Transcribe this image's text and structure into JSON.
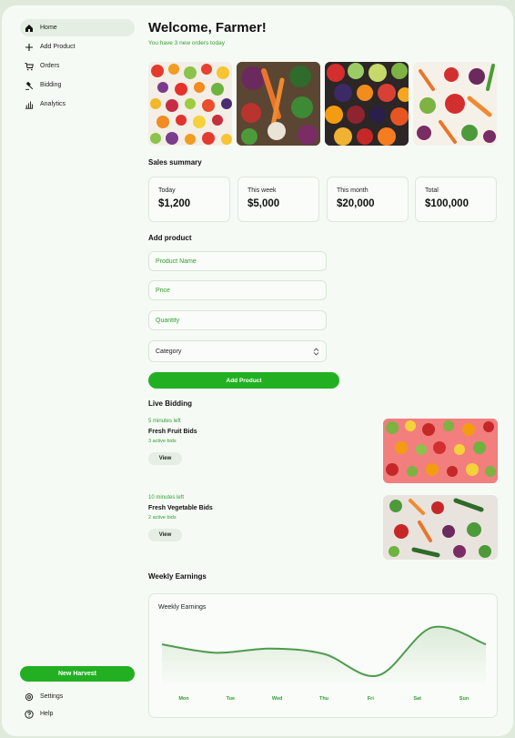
{
  "sidebar": {
    "items": [
      {
        "label": "Home",
        "icon": "home-icon",
        "active": true
      },
      {
        "label": "Add Product",
        "icon": "plus-icon"
      },
      {
        "label": "Orders",
        "icon": "cart-icon"
      },
      {
        "label": "Bidding",
        "icon": "gavel-icon"
      },
      {
        "label": "Analytics",
        "icon": "bar-chart-icon"
      }
    ],
    "new_harvest_label": "New Harvest",
    "settings_label": "Settings",
    "help_label": "Help"
  },
  "header": {
    "title": "Welcome, Farmer!",
    "subtitle": "You have 3 new orders today"
  },
  "sales": {
    "title": "Sales summary",
    "cards": [
      {
        "label": "Today",
        "value": "$1,200"
      },
      {
        "label": "This week",
        "value": "$5,000"
      },
      {
        "label": "This month",
        "value": "$20,000"
      },
      {
        "label": "Total",
        "value": "$100,000"
      }
    ]
  },
  "add_product": {
    "title": "Add product",
    "name_placeholder": "Product Name",
    "price_placeholder": "Price",
    "quantity_placeholder": "Quantity",
    "category_label": "Category",
    "submit_label": "Add Product"
  },
  "bidding": {
    "title": "Live Bidding",
    "items": [
      {
        "time_left": "5 minutes left",
        "title": "Fresh Fruit Bids",
        "bids": "3 active bids",
        "view_label": "View"
      },
      {
        "time_left": "10 minutes left",
        "title": "Fresh Vegetable Bids",
        "bids": "2 active bids",
        "view_label": "View"
      }
    ]
  },
  "earnings": {
    "section_title": "Weekly Earnings",
    "card_title": "Weekly Earnings"
  },
  "chart_data": {
    "type": "line",
    "title": "Weekly Earnings",
    "categories": [
      "Mon",
      "Tue",
      "Wed",
      "Thu",
      "Fri",
      "Sat",
      "Sun"
    ],
    "values": [
      62,
      48,
      55,
      46,
      10,
      90,
      62
    ],
    "ylim": [
      0,
      100
    ],
    "color": "#4f9a4f",
    "grid": false
  },
  "colors": {
    "accent": "#22b022",
    "text_accent": "#2fa02f"
  }
}
